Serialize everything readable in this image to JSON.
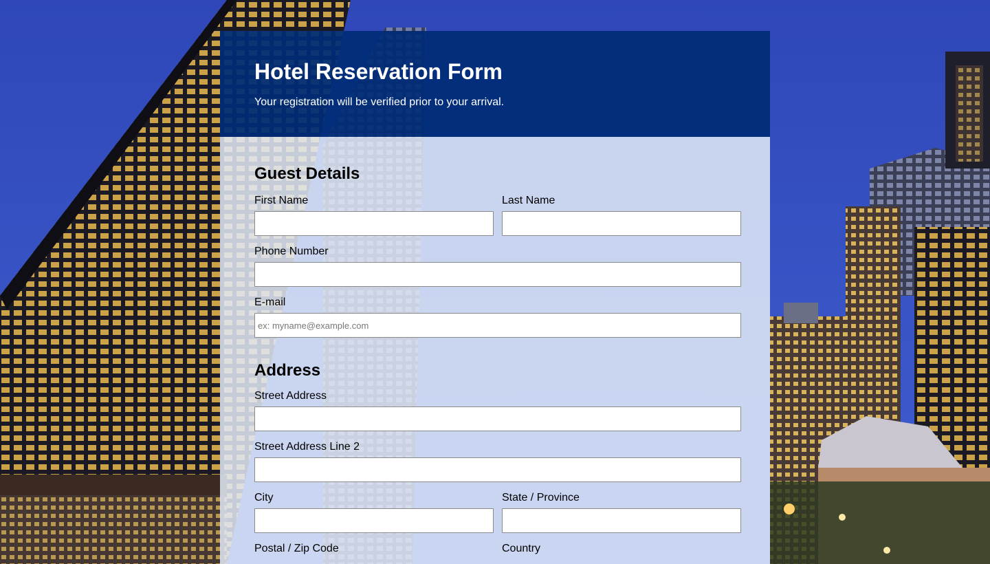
{
  "header": {
    "title": "Hotel Reservation Form",
    "subtitle": "Your registration will be verified prior to your arrival."
  },
  "guest_details": {
    "section_title": "Guest Details",
    "first_name": {
      "label": "First Name",
      "value": ""
    },
    "last_name": {
      "label": "Last Name",
      "value": ""
    },
    "phone": {
      "label": "Phone Number",
      "value": ""
    },
    "email": {
      "label": "E-mail",
      "placeholder": "ex: myname@example.com",
      "value": ""
    }
  },
  "address": {
    "section_title": "Address",
    "street": {
      "label": "Street Address",
      "value": ""
    },
    "street2": {
      "label": "Street Address Line 2",
      "value": ""
    },
    "city": {
      "label": "City",
      "value": ""
    },
    "state": {
      "label": "State / Province",
      "value": ""
    },
    "postal": {
      "label": "Postal / Zip Code"
    },
    "country": {
      "label": "Country"
    }
  },
  "colors": {
    "header_bg": "#002c76",
    "body_bg": "#e2eaf7",
    "sky": "#2b3fae"
  }
}
